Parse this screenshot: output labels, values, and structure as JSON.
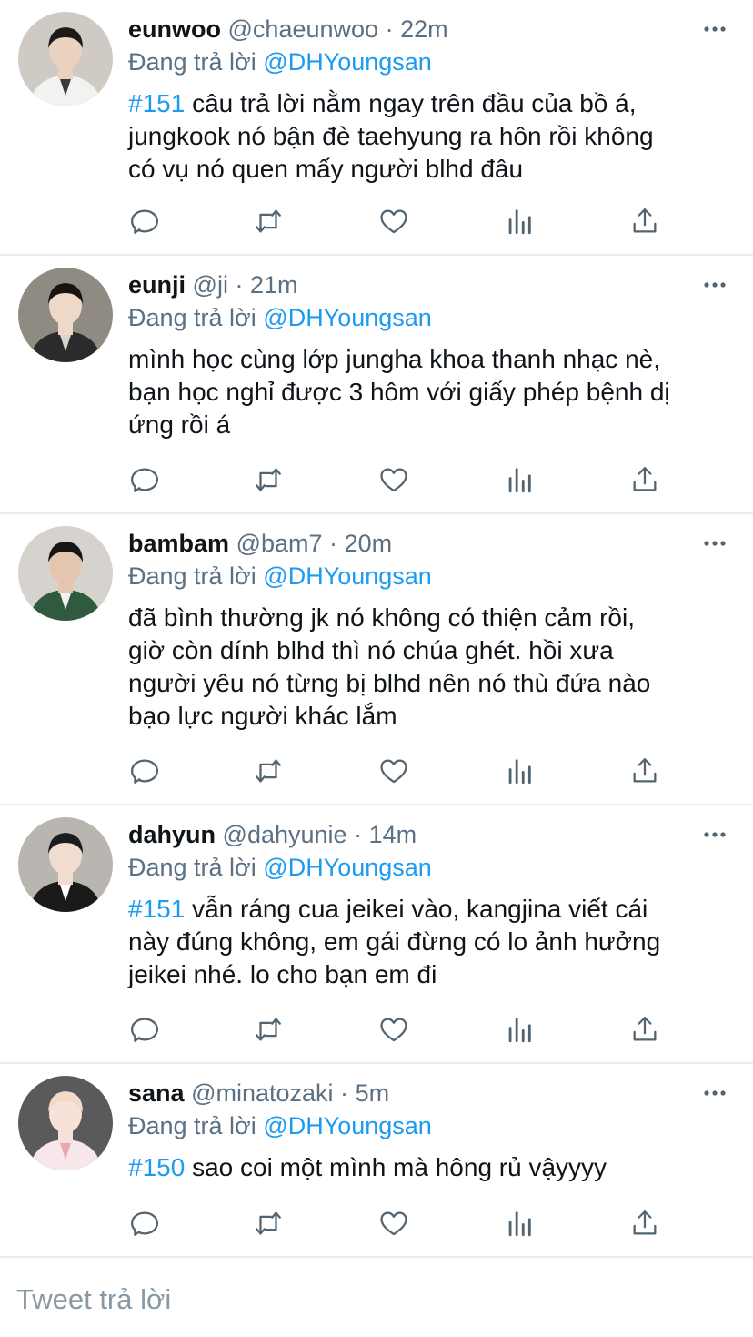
{
  "tweets": [
    {
      "name": "eunwoo",
      "handle": "@chaeunwoo",
      "separator": "·",
      "time": "22m",
      "reply_prefix": "Đang trả lời",
      "reply_to": "@DHYoungsan",
      "lines": [
        {
          "hashtag": "#151",
          "text": " câu trả lời nằm ngay trên đầu của bồ á,"
        },
        {
          "hashtag": "",
          "text": "jungkook nó bận đè taehyung ra hôn rồi không"
        },
        {
          "hashtag": "",
          "text": "có vụ nó quen mấy người blhd đâu"
        }
      ]
    },
    {
      "name": "eunji",
      "handle": "@ji",
      "separator": "·",
      "time": "21m",
      "reply_prefix": "Đang trả lời",
      "reply_to": "@DHYoungsan",
      "lines": [
        {
          "hashtag": "",
          "text": "mình học cùng lớp jungha khoa thanh nhạc nè,"
        },
        {
          "hashtag": "",
          "text": "bạn học nghỉ được 3 hôm với giấy phép bệnh dị"
        },
        {
          "hashtag": "",
          "text": "ứng rồi á"
        }
      ]
    },
    {
      "name": "bambam",
      "handle": "@bam7",
      "separator": "·",
      "time": "20m",
      "reply_prefix": "Đang trả lời",
      "reply_to": "@DHYoungsan",
      "lines": [
        {
          "hashtag": "",
          "text": "đã bình thường jk nó không có thiện cảm rồi,"
        },
        {
          "hashtag": "",
          "text": "giờ còn dính blhd thì nó chúa ghét. hồi xưa"
        },
        {
          "hashtag": "",
          "text": "người yêu nó từng bị blhd nên nó thù đứa nào"
        },
        {
          "hashtag": "",
          "text": "bạo lực người khác lắm"
        }
      ]
    },
    {
      "name": "dahyun",
      "handle": "@dahyunie",
      "separator": "·",
      "time": "14m",
      "reply_prefix": "Đang trả lời",
      "reply_to": "@DHYoungsan",
      "lines": [
        {
          "hashtag": "#151",
          "text": " vẫn ráng cua jeikei vào, kangjina viết cái"
        },
        {
          "hashtag": "",
          "text": "này đúng không, em gái đừng có lo ảnh hưởng"
        },
        {
          "hashtag": "",
          "text": "jeikei nhé. lo cho bạn em đi"
        }
      ]
    },
    {
      "name": "sana",
      "handle": "@minatozaki",
      "separator": "·",
      "time": "5m",
      "reply_prefix": "Đang trả lời",
      "reply_to": "@DHYoungsan",
      "lines": [
        {
          "hashtag": "#150",
          "text": " sao coi một mình mà hông rủ vậyyyy"
        }
      ]
    }
  ],
  "compose": {
    "placeholder": "Tweet trả lời"
  },
  "icons": {
    "actions": [
      "reply-icon",
      "retweet-icon",
      "like-icon",
      "analytics-icon",
      "share-icon"
    ],
    "more": "more-options-icon"
  },
  "colors": {
    "link": "#1d9bf0",
    "secondary_text": "#5b7083",
    "icon": "#536471",
    "divider": "#e6ecf0",
    "placeholder": "#8899a6"
  }
}
